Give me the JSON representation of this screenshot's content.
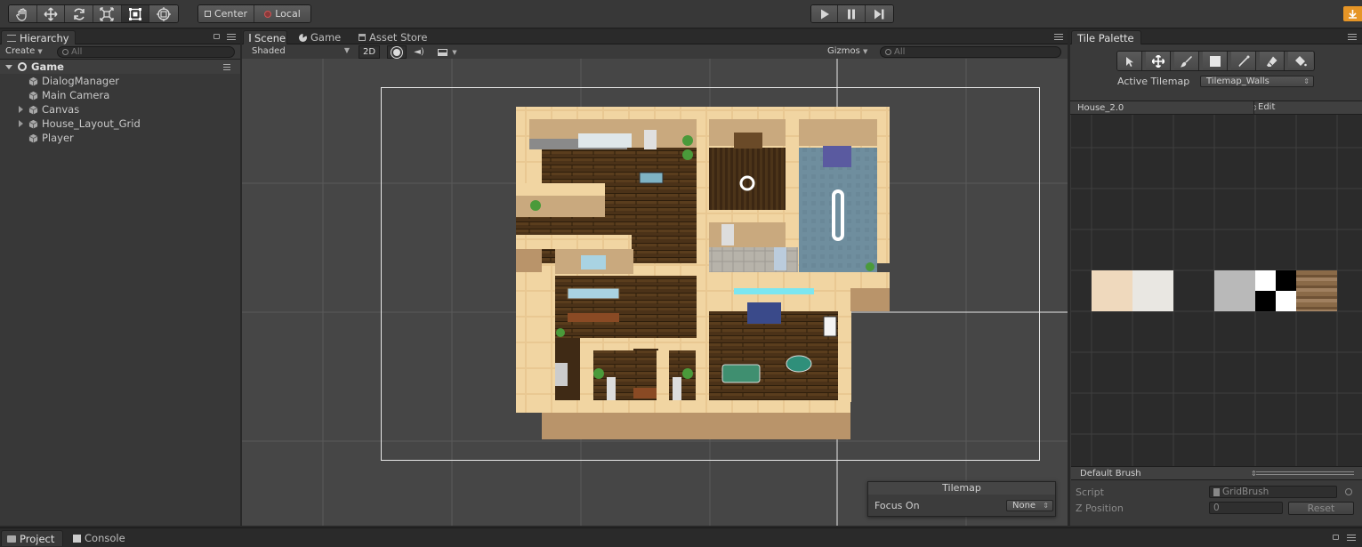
{
  "toolbar": {
    "tools": [
      {
        "icon": "hand-icon"
      },
      {
        "icon": "move-icon"
      },
      {
        "icon": "rotate-icon"
      },
      {
        "icon": "scale-icon"
      },
      {
        "icon": "rect-tool-icon",
        "active": true
      },
      {
        "icon": "transform-icon"
      }
    ],
    "pivot_label": "Center",
    "space_label": "Local",
    "play": {
      "play_icon": "play-icon",
      "pause_icon": "pause-icon",
      "step_icon": "step-icon"
    },
    "collab_icon": "cloud-download-icon",
    "accent": "#f0a030"
  },
  "hierarchy": {
    "tab_label": "Hierarchy",
    "create_label": "Create",
    "search_placeholder": "All",
    "scene_name": "Game",
    "items": [
      {
        "label": "DialogManager",
        "expandable": false
      },
      {
        "label": "Main Camera",
        "expandable": false
      },
      {
        "label": "Canvas",
        "expandable": true
      },
      {
        "label": "House_Layout_Grid",
        "expandable": true
      },
      {
        "label": "Player",
        "expandable": false
      }
    ]
  },
  "scene_view": {
    "tabs": [
      {
        "label": "Scene",
        "icon": "grid-icon",
        "active": true
      },
      {
        "label": "Game",
        "icon": "pacman-icon",
        "active": false
      },
      {
        "label": "Asset Store",
        "icon": "store-icon",
        "active": false
      }
    ],
    "shading_mode": "Shaded",
    "mode_2d": "2D",
    "gizmos_label": "Gizmos",
    "search_placeholder": "All",
    "background": "#464646",
    "overlay": {
      "title": "Tilemap",
      "focus_label": "Focus On",
      "focus_value": "None"
    }
  },
  "tile_palette": {
    "tab_label": "Tile Palette",
    "tools": [
      {
        "icon": "select-arrow-icon"
      },
      {
        "icon": "move-icon"
      },
      {
        "icon": "paintbrush-icon"
      },
      {
        "icon": "box-fill-icon"
      },
      {
        "icon": "picker-icon"
      },
      {
        "icon": "eraser-icon"
      },
      {
        "icon": "fill-bucket-icon"
      }
    ],
    "active_tilemap_label": "Active Tilemap",
    "active_tilemap_value": "Tilemap_Walls",
    "palette_name": "House_2.0",
    "edit_label": "Edit",
    "tiles": [
      {
        "color": "#efd9bd"
      },
      {
        "color": "#e9e7e2"
      },
      {
        "color": "#2b2b2b"
      },
      {
        "color": "#b9b9b9"
      },
      {
        "color": "checker"
      },
      {
        "color": "wood"
      }
    ],
    "brush_label": "Default Brush",
    "script_label": "Script",
    "script_value": "GridBrush",
    "zpos_label": "Z Position",
    "zpos_value": "0",
    "reset_label": "Reset"
  },
  "bottom": {
    "tabs": [
      {
        "label": "Project",
        "icon": "folder-icon"
      },
      {
        "label": "Console",
        "icon": "console-icon"
      }
    ]
  }
}
